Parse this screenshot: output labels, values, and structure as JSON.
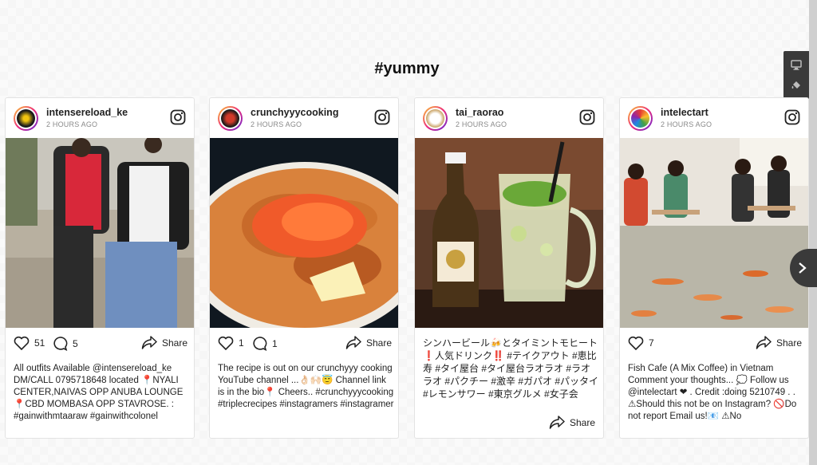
{
  "heading": "#yummy",
  "toolbar": {
    "display_icon": "monitor-icon",
    "paint_icon": "paint-bucket-icon"
  },
  "posts": [
    {
      "username": "intensereload_ke",
      "time": "2 HOURS AGO",
      "likes": "51",
      "comments": "5",
      "share": "Share",
      "caption": "All outfits Available @intensereload_ke DM/CALL 0795718648 located 📍NYALI CENTER,NAIVAS OPP ANUBA LOUNGE 📍CBD MOMBASA OPP STAVROSE. : #gainwithmtaaraw #gainwithcolonel"
    },
    {
      "username": "crunchyyycooking",
      "time": "2 HOURS AGO",
      "likes": "1",
      "comments": "1",
      "share": "Share",
      "caption": "The recipe is out on our crunchyyy cooking YouTube channel ...👌🏻🙌🏻😇 Channel link is in the bio📍 Cheers.. #crunchyyycooking #triplecrecipes #instagramers #instagramer"
    },
    {
      "username": "tai_raorao",
      "time": "2 HOURS AGO",
      "share": "Share",
      "caption": "シンハービール🍻とタイミントモヒート❗️人気ドリンク‼️ #テイクアウト #恵比寿 #タイ屋台 #タイ屋台ラオラオ #ラオラオ #パクチー #激辛 #ガパオ #パッタイ #レモンサワー #東京グルメ #女子会"
    },
    {
      "username": "intelectart",
      "time": "2 HOURS AGO",
      "likes": "7",
      "share": "Share",
      "caption": "Fish Cafe (A Mix Coffee) in Vietnam Comment your thoughts... 💭 Follow us @intelectart ❤ . Credit :doing 5210749 . . ⚠Should this not be on Instagram? 🚫Do not report Email us!📧 ⚠No"
    }
  ],
  "colors": {
    "accent_gradient": [
      "#f9ce34",
      "#ee2a7b",
      "#6228d7"
    ],
    "panel": "#3a3a3a"
  }
}
